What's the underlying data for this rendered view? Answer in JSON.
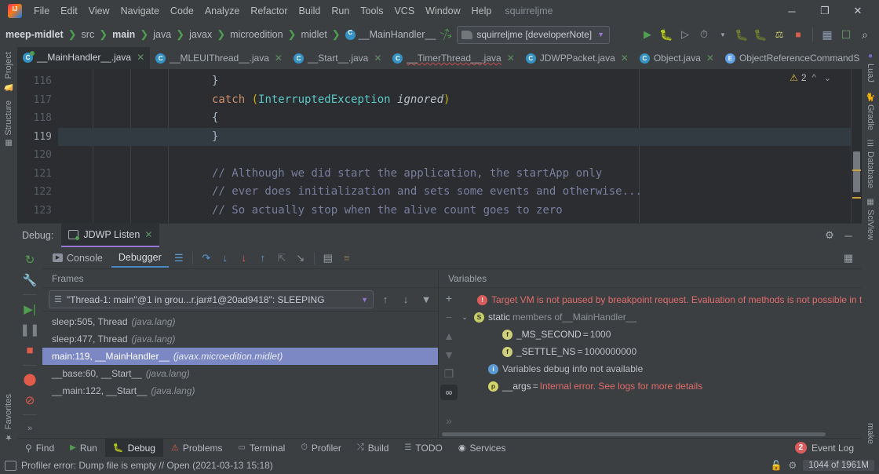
{
  "menu": {
    "items": [
      "File",
      "Edit",
      "View",
      "Navigate",
      "Code",
      "Analyze",
      "Refactor",
      "Build",
      "Run",
      "Tools",
      "VCS",
      "Window",
      "Help"
    ],
    "project_name": "squirreljme",
    "window_minimize": "─",
    "window_maximize": "❐",
    "window_close": "✕"
  },
  "breadcrumb": {
    "items": [
      "meep-midlet",
      "src",
      "main",
      "java",
      "javax",
      "microedition",
      "midlet",
      "__MainHandler__"
    ]
  },
  "toolbar": {
    "run_config": "squirreljme [developerNote]",
    "run_icon": "▶",
    "debug_icon": "debug-bug-icon",
    "search_icon": "⌕"
  },
  "editor_tabs": [
    {
      "label": "__MainHandler__.java",
      "icon": "java-class-runnable-icon",
      "active": true,
      "closable": true
    },
    {
      "label": "__MLEUIThread__.java",
      "icon": "java-class-icon",
      "active": false,
      "closable": true
    },
    {
      "label": "__Start__.java",
      "icon": "java-class-icon",
      "active": false,
      "closable": true
    },
    {
      "label": "__TimerThread__.java",
      "icon": "java-class-icon",
      "active": false,
      "closable": true,
      "wavy": true
    },
    {
      "label": "JDWPPacket.java",
      "icon": "java-class-icon",
      "active": false,
      "closable": true
    },
    {
      "label": "Object.java",
      "icon": "java-class-icon",
      "active": false,
      "closable": true
    },
    {
      "label": "ObjectReferenceCommandS",
      "icon": "java-enum-icon",
      "active": false,
      "closable": false
    }
  ],
  "editor": {
    "warning_count": "2",
    "warning_icon": "⚠",
    "lines": [
      {
        "num": "116",
        "highlight": false,
        "tokens": [
          {
            "t": "}",
            "c": "br"
          }
        ],
        "indent": 3
      },
      {
        "num": "117",
        "highlight": false,
        "tokens": [
          {
            "t": "catch ",
            "c": "kw"
          },
          {
            "t": "(",
            "c": "par"
          },
          {
            "t": "InterruptedException ",
            "c": "ty"
          },
          {
            "t": "ignored",
            "c": "it"
          },
          {
            "t": ")",
            "c": "par"
          }
        ],
        "indent": 3
      },
      {
        "num": "118",
        "highlight": false,
        "tokens": [
          {
            "t": "{",
            "c": "br"
          }
        ],
        "indent": 3
      },
      {
        "num": "119",
        "highlight": true,
        "tokens": [
          {
            "t": "}",
            "c": "br"
          }
        ],
        "indent": 3
      },
      {
        "num": "120",
        "highlight": false,
        "tokens": [],
        "indent": 3
      },
      {
        "num": "121",
        "highlight": false,
        "tokens": [
          {
            "t": "// Although we did start the application, the startApp only",
            "c": "cm"
          }
        ],
        "indent": 3
      },
      {
        "num": "122",
        "highlight": false,
        "tokens": [
          {
            "t": "// ever does initialization and sets some events and otherwise...",
            "c": "cm"
          }
        ],
        "indent": 3
      },
      {
        "num": "123",
        "highlight": false,
        "tokens": [
          {
            "t": "// So actually stop when the alive count goes to zero",
            "c": "cm"
          }
        ],
        "indent": 3
      }
    ]
  },
  "left_stripe": [
    {
      "label": "Project",
      "icon": "folder-icon"
    },
    {
      "label": "Structure",
      "icon": "structure-icon"
    },
    {
      "label": "Favorites",
      "icon": "star-icon"
    }
  ],
  "right_stripe": [
    {
      "label": "LuaJ",
      "icon": "luaj-icon"
    },
    {
      "label": "Gradle",
      "icon": "gradle-icon"
    },
    {
      "label": "Database",
      "icon": "database-icon"
    },
    {
      "label": "SciView",
      "icon": "sciview-icon"
    },
    {
      "label": "make",
      "icon": "make-icon"
    }
  ],
  "debug": {
    "window_label": "Debug:",
    "session_tab": "JDWP Listen",
    "gear_icon": "⚙",
    "minimize_icon": "─",
    "tabs": [
      {
        "label": "Console",
        "icon": "console-icon",
        "active": false
      },
      {
        "label": "Debugger",
        "icon": "debugger-icon",
        "active": true
      }
    ],
    "toolbar_icons": [
      "layout-icon",
      "step-over-icon",
      "step-into-icon",
      "force-step-into-icon",
      "step-out-icon",
      "drop-frame-icon",
      "run-to-cursor-icon",
      "evaluate-icon",
      "settings-icon"
    ],
    "left_icons": [
      "rerun-icon",
      "settings-wrench-icon",
      "resume-icon",
      "pause-icon",
      "stop-icon",
      "breakpoints-icon",
      "mute-breakpoints-icon",
      "more-icon"
    ],
    "frames": {
      "title": "Frames",
      "thread": "\"Thread-1: main\"@1 in grou...r.jar#1@20ad9418\": SLEEPING",
      "toolbar_icons": [
        "up-arrow-icon",
        "down-arrow-icon",
        "filter-icon"
      ],
      "rows": [
        {
          "method": "sleep:505, Thread",
          "package": "(java.lang)",
          "selected": false
        },
        {
          "method": "sleep:477, Thread",
          "package": "(java.lang)",
          "selected": false
        },
        {
          "method": "main:119, __MainHandler__",
          "package": "(javax.microedition.midlet)",
          "selected": true
        },
        {
          "method": "__base:60, __Start__",
          "package": "(java.lang)",
          "selected": false
        },
        {
          "method": "__main:122, __Start__",
          "package": "(java.lang)",
          "selected": false
        }
      ]
    },
    "variables": {
      "title": "Variables",
      "tool_icons": [
        "+",
        "−",
        "▲",
        "▼",
        "copy-icon",
        "watches-icon",
        "more-icon"
      ],
      "rows": [
        {
          "badge": "err",
          "badge_char": "!",
          "chevron": "",
          "segments": [
            {
              "t": "Target VM is not paused by breakpoint request. Evaluation of methods is not possible in th",
              "c": "t-err"
            }
          ],
          "indent": 18
        },
        {
          "badge": "s",
          "badge_char": "S",
          "chevron": "⌄",
          "segments": [
            {
              "t": "static",
              "c": "t-kw"
            },
            {
              "t": " members of ",
              "c": "t-dim"
            },
            {
              "t": "__MainHandler__",
              "c": "t-dim"
            }
          ],
          "indent": 0
        },
        {
          "badge": "f",
          "badge_char": "f",
          "chevron": "",
          "segments": [
            {
              "t": "_MS_SECOND",
              "c": "t-name"
            },
            {
              "t": " = ",
              "c": "t-val"
            },
            {
              "t": "1000",
              "c": "t-val"
            }
          ],
          "indent": 36
        },
        {
          "badge": "f",
          "badge_char": "f",
          "chevron": "",
          "segments": [
            {
              "t": "_SETTLE_NS",
              "c": "t-name"
            },
            {
              "t": " = ",
              "c": "t-val"
            },
            {
              "t": "1000000000",
              "c": "t-val"
            }
          ],
          "indent": 36
        },
        {
          "badge": "i",
          "badge_char": "i",
          "chevron": "",
          "segments": [
            {
              "t": "Variables debug info not available",
              "c": "t-val"
            }
          ],
          "indent": 18
        },
        {
          "badge": "p",
          "badge_char": "p",
          "chevron": "",
          "segments": [
            {
              "t": "__args",
              "c": "t-name"
            },
            {
              "t": " = ",
              "c": "t-val"
            },
            {
              "t": "Internal error. See logs for more details",
              "c": "t-err"
            }
          ],
          "indent": 18
        }
      ]
    }
  },
  "tool_buttons": [
    {
      "label": "Find",
      "icon": "search-icon",
      "active": false
    },
    {
      "label": "Run",
      "icon": "run-icon",
      "active": false
    },
    {
      "label": "Debug",
      "icon": "debug-icon",
      "active": true
    },
    {
      "label": "Problems",
      "icon": "problems-icon",
      "active": false
    },
    {
      "label": "Terminal",
      "icon": "terminal-icon",
      "active": false
    },
    {
      "label": "Profiler",
      "icon": "profiler-icon",
      "active": false
    },
    {
      "label": "Build",
      "icon": "build-hammer-icon",
      "active": false
    },
    {
      "label": "TODO",
      "icon": "todo-icon",
      "active": false
    },
    {
      "label": "Services",
      "icon": "services-icon",
      "active": false
    }
  ],
  "event_log": {
    "label": "Event Log",
    "count": "2"
  },
  "statusbar": {
    "message": "Profiler error: Dump file is empty // Open (2021-03-13 15:18)",
    "memory": "1044 of 1961M",
    "lock_icon": "lock-icon",
    "inspection_icon": "inspection-icon"
  },
  "colors": {
    "accent_purple": "#9876d6",
    "accent_blue": "#4a88c7",
    "selection": "#7b88c4",
    "error_red": "#e06c6c",
    "green": "#4f9e52",
    "warning_yellow": "#e2b93d"
  }
}
